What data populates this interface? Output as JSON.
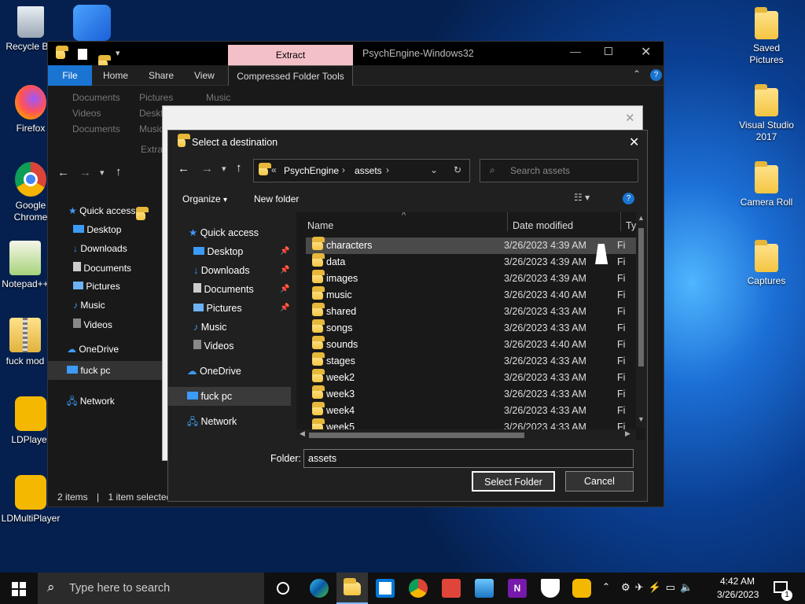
{
  "desktop": {
    "icons_left": [
      {
        "label": "Recycle Bin"
      },
      {
        "label": ""
      },
      {
        "label": "Firefox"
      },
      {
        "label": "Google Chrome"
      },
      {
        "label": "Notepad++"
      },
      {
        "label": "fuck mod"
      },
      {
        "label": "LDPlayer"
      },
      {
        "label": "LDMultiPlayer"
      }
    ],
    "icons_right": [
      {
        "label": "Saved Pictures"
      },
      {
        "label": "Visual Studio 2017"
      },
      {
        "label": "Camera Roll"
      },
      {
        "label": "Captures"
      }
    ]
  },
  "explorer": {
    "title": "PsychEngine-Windows32",
    "context_tab": "Extract",
    "tabs": [
      "File",
      "Home",
      "Share",
      "View",
      "Compressed Folder Tools"
    ],
    "ribbon_dest": [
      "Documents",
      "Pictures",
      "Music",
      "Videos",
      "Deskt",
      "Documents",
      "Music"
    ],
    "extract_label": "Extra",
    "nav": [
      {
        "label": "Quick access"
      },
      {
        "label": "Desktop"
      },
      {
        "label": "Downloads"
      },
      {
        "label": "Documents"
      },
      {
        "label": "Pictures"
      },
      {
        "label": "Music"
      },
      {
        "label": "Videos"
      },
      {
        "label": "OneDrive"
      },
      {
        "label": "fuck pc"
      },
      {
        "label": "Network"
      }
    ],
    "status": {
      "items": "2 items",
      "sep": "|",
      "selected": "1 item selected"
    }
  },
  "dialog": {
    "title": "Select a destination",
    "breadcrumb": {
      "prefix": "«",
      "parts": [
        "PsychEngine",
        "assets"
      ]
    },
    "search_placeholder": "Search assets",
    "toolbar": {
      "organize": "Organize",
      "new_folder": "New folder"
    },
    "nav": [
      {
        "label": "Quick access"
      },
      {
        "label": "Desktop"
      },
      {
        "label": "Downloads"
      },
      {
        "label": "Documents"
      },
      {
        "label": "Pictures"
      },
      {
        "label": "Music"
      },
      {
        "label": "Videos"
      },
      {
        "label": "OneDrive"
      },
      {
        "label": "fuck pc"
      },
      {
        "label": "Network"
      }
    ],
    "columns": {
      "name": "Name",
      "date": "Date modified",
      "type": "Ty"
    },
    "files": [
      {
        "name": "characters",
        "date": "3/26/2023 4:39 AM",
        "type": "Fi"
      },
      {
        "name": "data",
        "date": "3/26/2023 4:39 AM",
        "type": "Fi"
      },
      {
        "name": "images",
        "date": "3/26/2023 4:39 AM",
        "type": "Fi"
      },
      {
        "name": "music",
        "date": "3/26/2023 4:40 AM",
        "type": "Fi"
      },
      {
        "name": "shared",
        "date": "3/26/2023 4:33 AM",
        "type": "Fi"
      },
      {
        "name": "songs",
        "date": "3/26/2023 4:33 AM",
        "type": "Fi"
      },
      {
        "name": "sounds",
        "date": "3/26/2023 4:40 AM",
        "type": "Fi"
      },
      {
        "name": "stages",
        "date": "3/26/2023 4:33 AM",
        "type": "Fi"
      },
      {
        "name": "week2",
        "date": "3/26/2023 4:33 AM",
        "type": "Fi"
      },
      {
        "name": "week3",
        "date": "3/26/2023 4:33 AM",
        "type": "Fi"
      },
      {
        "name": "week4",
        "date": "3/26/2023 4:33 AM",
        "type": "Fi"
      },
      {
        "name": "week5",
        "date": "3/26/2023 4:33 AM",
        "type": "Fi"
      }
    ],
    "folder_label": "Folder:",
    "folder_value": "assets",
    "select_button": "Select Folder",
    "cancel_button": "Cancel"
  },
  "taskbar": {
    "search_placeholder": "Type here to search",
    "time": "4:42 AM",
    "date": "3/26/2023",
    "notification_count": "1"
  },
  "colors": {
    "accent": "#0078d7",
    "selection": "#4a4a4a",
    "folder": "#f4c542"
  }
}
